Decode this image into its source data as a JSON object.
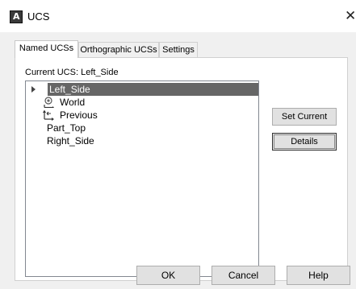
{
  "window": {
    "title": "UCS",
    "close_glyph": "✕"
  },
  "tabs": [
    "Named UCSs",
    "Orthographic UCSs",
    "Settings"
  ],
  "current_ucs": {
    "label": "Current UCS:",
    "value": "Left_Side"
  },
  "ucs_list": [
    {
      "label": "Left_Side",
      "icon": "",
      "selected": true,
      "has_arrow": true
    },
    {
      "label": "World",
      "icon": "world-ucs-icon"
    },
    {
      "label": "Previous",
      "icon": "previous-ucs-icon"
    },
    {
      "label": "Part_Top",
      "icon": ""
    },
    {
      "label": "Right_Side",
      "icon": ""
    }
  ],
  "side_buttons": {
    "set_current": "Set Current",
    "details": "Details"
  },
  "footer_buttons": {
    "ok": "OK",
    "cancel": "Cancel",
    "help": "Help"
  }
}
